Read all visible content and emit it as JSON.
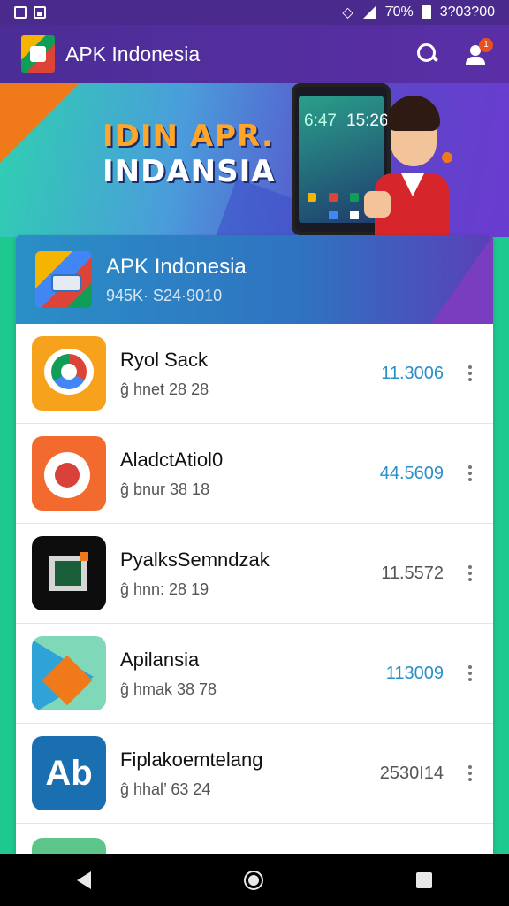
{
  "status_bar": {
    "battery_text": "7̇0%",
    "time_text": "3?03?00",
    "icons": [
      "notification-square-icon",
      "image-icon",
      "wifi-icon",
      "signal-icon",
      "battery-icon"
    ]
  },
  "app_bar": {
    "title": "APK Indonesia",
    "icons": [
      "app-logo-icon",
      "search-icon",
      "notification-user-icon"
    ],
    "badge_count": "1"
  },
  "banner": {
    "line1": "IDIN APR.",
    "line2": "INDANSIA",
    "phone_time1": "6:47",
    "phone_time2": "15:26"
  },
  "card": {
    "title": "APK Indonesia",
    "subtitle": "945K· S24·9010",
    "apps": [
      {
        "name": "Ryol Sack",
        "meta": "ĝ hnet 28 28",
        "count": "11.3006",
        "icon": "chrome-style-icon",
        "count_color": "#2a8fc7"
      },
      {
        "name": "AladctAtiol0",
        "meta": "ĝ bnur 38 18",
        "count": "44.5609",
        "icon": "gear-app-icon",
        "count_color": "#2a8fc7"
      },
      {
        "name": "PyalksSemndzak",
        "meta": "ĝ hnn: 28 19",
        "count": "11.5572",
        "icon": "terminal-app-icon",
        "count_color": "#555555"
      },
      {
        "name": "Apilansia",
        "meta": "ĝ hmak 38 78",
        "count": "113009",
        "icon": "play-store-icon",
        "count_color": "#2a8fc7"
      },
      {
        "name": "Fiplakoemtelang",
        "meta": "ĝ hhal’ 63 24",
        "count": "2530I14",
        "icon": "ab-app-icon",
        "count_color": "#555555"
      }
    ]
  },
  "nav_bar": {
    "icons": [
      "back-icon",
      "home-icon",
      "recent-apps-icon"
    ]
  },
  "colors": {
    "header_purple": "#4b2d96",
    "accent_green": "#1dc98f",
    "count_blue": "#2a8fc7"
  }
}
